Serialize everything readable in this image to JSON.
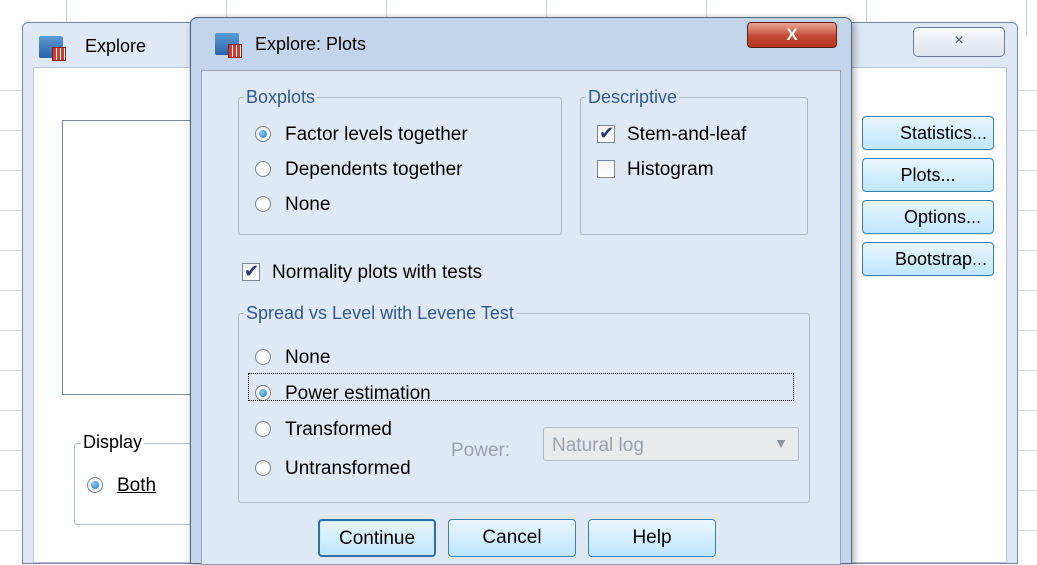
{
  "explore_window": {
    "title": "Explore",
    "close_icon": "×",
    "display_legend": "Display",
    "display_both": "Both",
    "buttons": [
      "Statistics...",
      "Plots...",
      "Options...",
      "Bootstrap..."
    ]
  },
  "dialog": {
    "title": "Explore: Plots",
    "close_label": "X",
    "boxplots": {
      "legend": "Boxplots",
      "options": [
        {
          "label": "Factor levels together",
          "selected": true
        },
        {
          "label": "Dependents together",
          "selected": false
        },
        {
          "label": "None",
          "selected": false
        }
      ]
    },
    "descriptive": {
      "legend": "Descriptive",
      "options": [
        {
          "label": "Stem-and-leaf",
          "checked": true
        },
        {
          "label": "Histogram",
          "checked": false
        }
      ]
    },
    "normality": {
      "label": "Normality plots with tests",
      "checked": true
    },
    "spread": {
      "legend": "Spread vs Level with Levene Test",
      "options": [
        {
          "label": "None",
          "selected": false
        },
        {
          "label": "Power estimation",
          "selected": true
        },
        {
          "label": "Transformed",
          "selected": false
        },
        {
          "label": "Untransformed",
          "selected": false
        }
      ],
      "power_label": "Power:",
      "power_value": "Natural log"
    },
    "buttons": {
      "continue": "Continue",
      "cancel": "Cancel",
      "help": "Help"
    }
  },
  "colors": {
    "group_legend": "#33588c",
    "dialog_frame": "#c3d5ea",
    "body": "#dfe9f5"
  }
}
